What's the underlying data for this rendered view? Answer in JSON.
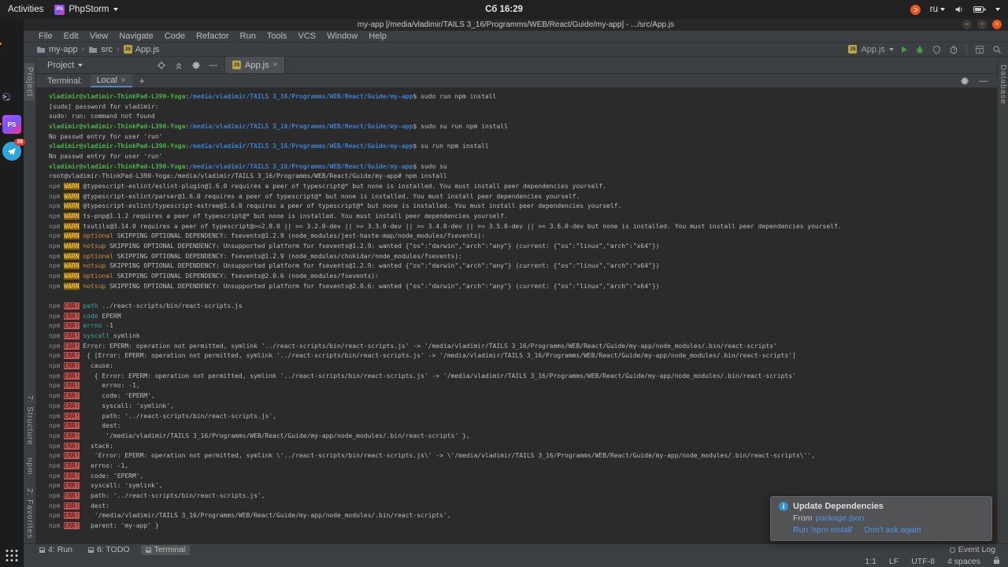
{
  "ubuntu_bar": {
    "activities": "Activities",
    "app_name": "PhpStorm",
    "clock": "Сб 16:29",
    "lang": "ru"
  },
  "window": {
    "title": "my-app [/media/vladimir/TAILS 3_16/Programms/WEB/React/Guide/my-app] - .../src/App.js"
  },
  "menu": {
    "items": [
      "File",
      "Edit",
      "View",
      "Navigate",
      "Code",
      "Refactor",
      "Run",
      "Tools",
      "VCS",
      "Window",
      "Help"
    ]
  },
  "breadcrumbs": {
    "items": [
      "my-app",
      "src",
      "App.js"
    ]
  },
  "run_widget": {
    "config": "App.js"
  },
  "project_panel": {
    "title": "Project"
  },
  "editor_tabs": {
    "active": "App.js"
  },
  "terminal_panel": {
    "label": "Terminal:",
    "tab": "Local"
  },
  "tool_stripes": {
    "left_top": "Project",
    "left_bottom": [
      "7: Structure",
      "npm",
      "2: Favorites"
    ],
    "right": "Database"
  },
  "bottom_bar": {
    "buttons": [
      "4: Run",
      "6: TODO",
      "Terminal"
    ],
    "event_log": "Event Log"
  },
  "status_bar": {
    "position": "1:1",
    "line_ending": "LF",
    "encoding": "UTF-8",
    "indent": "4 spaces"
  },
  "dock": {
    "badge": "39",
    "phpstorm_label": "PS",
    "terminal_glyph": "&gt;_"
  },
  "notification": {
    "title": "Update Dependencies",
    "from_prefix": "From",
    "from_link": "package.json",
    "action_run": "Run 'npm install'",
    "action_dismiss": "Don't ask again"
  },
  "colors": {
    "accent_link": "#5394ec",
    "terminal_green": "#4ab44a",
    "terminal_blue": "#3e7fd0",
    "warn_badge_bg": "#8a5f00",
    "error_badge_bg": "#c75450",
    "close_button": "#e95420"
  },
  "terminal": {
    "lines": [
      [
        [
          "u",
          "vladimir@vladimir-ThinkPad-L390-Yoga"
        ],
        [
          "",
          ":"
        ],
        [
          "p",
          "/media/vladimir/TAILS 3_16/Programms/WEB/React/Guide/my-app"
        ],
        [
          "",
          "$ sudo run npm install"
        ]
      ],
      [
        [
          "",
          "[sudo] password for vladimir: "
        ]
      ],
      [
        [
          "",
          "sudo: run: command not found"
        ]
      ],
      [
        [
          "u",
          "vladimir@vladimir-ThinkPad-L390-Yoga"
        ],
        [
          "",
          ":"
        ],
        [
          "p",
          "/media/vladimir/TAILS 3_16/Programms/WEB/React/Guide/my-app"
        ],
        [
          "",
          "$ sudo su run npm install"
        ]
      ],
      [
        [
          "",
          "No passwd entry for user 'run'"
        ]
      ],
      [
        [
          "u",
          "vladimir@vladimir-ThinkPad-L390-Yoga"
        ],
        [
          "",
          ":"
        ],
        [
          "p",
          "/media/vladimir/TAILS 3_16/Programms/WEB/React/Guide/my-app"
        ],
        [
          "",
          "$ su run npm install"
        ]
      ],
      [
        [
          "",
          "No passwd entry for user 'run'"
        ]
      ],
      [
        [
          "u",
          "vladimir@vladimir-ThinkPad-L390-Yoga"
        ],
        [
          "",
          ":"
        ],
        [
          "p",
          "/media/vladimir/TAILS 3_16/Programms/WEB/React/Guide/my-app"
        ],
        [
          "",
          "$ sudo su"
        ]
      ],
      [
        [
          "",
          "root@vladimir-ThinkPad-L390-Yoga:/media/vladimir/TAILS 3_16/Programms/WEB/React/Guide/my-app# npm install"
        ]
      ],
      [
        [
          "n",
          "npm "
        ],
        [
          "w",
          "WARN"
        ],
        [
          "",
          " @typescript-eslint/eslint-plugin@1.6.0 requires a peer of typescript@* but none is installed. You must install peer dependencies yourself."
        ]
      ],
      [
        [
          "n",
          "npm "
        ],
        [
          "w",
          "WARN"
        ],
        [
          "",
          " @typescript-eslint/parser@1.6.0 requires a peer of typescript@* but none is installed. You must install peer dependencies yourself."
        ]
      ],
      [
        [
          "n",
          "npm "
        ],
        [
          "w",
          "WARN"
        ],
        [
          "",
          " @typescript-eslint/typescript-estree@1.6.0 requires a peer of typescript@* but none is installed. You must install peer dependencies yourself."
        ]
      ],
      [
        [
          "n",
          "npm "
        ],
        [
          "w",
          "WARN"
        ],
        [
          "",
          " ts-pnp@1.1.2 requires a peer of typescript@* but none is installed. You must install peer dependencies yourself."
        ]
      ],
      [
        [
          "n",
          "npm "
        ],
        [
          "w",
          "WARN"
        ],
        [
          "",
          " tsutils@3.14.0 requires a peer of typescript@>=2.8.0 || >= 3.2.0-dev || >= 3.3.0-dev || >= 3.4.0-dev || >= 3.5.0-dev || >= 3.6.0-dev but none is installed. You must install peer dependencies yourself."
        ]
      ],
      [
        [
          "n",
          "npm "
        ],
        [
          "w",
          "WARN"
        ],
        [
          "",
          " "
        ],
        [
          "o",
          "optional"
        ],
        [
          "",
          " SKIPPING OPTIONAL DEPENDENCY: fsevents@1.2.9 (node_modules/jest-haste-map/node_modules/fsevents):"
        ]
      ],
      [
        [
          "n",
          "npm "
        ],
        [
          "w",
          "WARN"
        ],
        [
          "",
          " "
        ],
        [
          "o",
          "notsup"
        ],
        [
          "",
          " SKIPPING OPTIONAL DEPENDENCY: Unsupported platform for fsevents@1.2.9: wanted {\"os\":\"darwin\",\"arch\":\"any\"} (current: {\"os\":\"linux\",\"arch\":\"x64\"})"
        ]
      ],
      [
        [
          "n",
          "npm "
        ],
        [
          "w",
          "WARN"
        ],
        [
          "",
          " "
        ],
        [
          "o",
          "optional"
        ],
        [
          "",
          " SKIPPING OPTIONAL DEPENDENCY: fsevents@1.2.9 (node_modules/chokidar/node_modules/fsevents):"
        ]
      ],
      [
        [
          "n",
          "npm "
        ],
        [
          "w",
          "WARN"
        ],
        [
          "",
          " "
        ],
        [
          "o",
          "notsup"
        ],
        [
          "",
          " SKIPPING OPTIONAL DEPENDENCY: Unsupported platform for fsevents@1.2.9: wanted {\"os\":\"darwin\",\"arch\":\"any\"} (current: {\"os\":\"linux\",\"arch\":\"x64\"})"
        ]
      ],
      [
        [
          "n",
          "npm "
        ],
        [
          "w",
          "WARN"
        ],
        [
          "",
          " "
        ],
        [
          "o",
          "optional"
        ],
        [
          "",
          " SKIPPING OPTIONAL DEPENDENCY: fsevents@2.0.6 (node_modules/fsevents):"
        ]
      ],
      [
        [
          "n",
          "npm "
        ],
        [
          "w",
          "WARN"
        ],
        [
          "",
          " "
        ],
        [
          "o",
          "notsup"
        ],
        [
          "",
          " SKIPPING OPTIONAL DEPENDENCY: Unsupported platform for fsevents@2.0.6: wanted {\"os\":\"darwin\",\"arch\":\"any\"} (current: {\"os\":\"linux\",\"arch\":\"x64\"})"
        ]
      ],
      [],
      [
        [
          "n",
          "npm "
        ],
        [
          "e",
          "ERR!"
        ],
        [
          "",
          " "
        ],
        [
          "k",
          "path"
        ],
        [
          "",
          " ../react-scripts/bin/react-scripts.js"
        ]
      ],
      [
        [
          "n",
          "npm "
        ],
        [
          "e",
          "ERR!"
        ],
        [
          "",
          " "
        ],
        [
          "k",
          "code"
        ],
        [
          "",
          " EPERM"
        ]
      ],
      [
        [
          "n",
          "npm "
        ],
        [
          "e",
          "ERR!"
        ],
        [
          "",
          " "
        ],
        [
          "k",
          "errno"
        ],
        [
          "",
          " -1"
        ]
      ],
      [
        [
          "n",
          "npm "
        ],
        [
          "e",
          "ERR!"
        ],
        [
          "",
          " "
        ],
        [
          "k",
          "syscall"
        ],
        [
          "",
          " symlink"
        ]
      ],
      [
        [
          "n",
          "npm "
        ],
        [
          "e",
          "ERR!"
        ],
        [
          "",
          " Error: EPERM: operation not permitted, symlink '../react-scripts/bin/react-scripts.js' -> '/media/vladimir/TAILS 3_16/Programms/WEB/React/Guide/my-app/node_modules/.bin/react-scripts'"
        ]
      ],
      [
        [
          "n",
          "npm "
        ],
        [
          "e",
          "ERR!"
        ],
        [
          "",
          "  { [Error: EPERM: operation not permitted, symlink '../react-scripts/bin/react-scripts.js' -> '/media/vladimir/TAILS 3_16/Programms/WEB/React/Guide/my-app/node_modules/.bin/react-scripts']"
        ]
      ],
      [
        [
          "n",
          "npm "
        ],
        [
          "e",
          "ERR!"
        ],
        [
          "",
          "   cause:"
        ]
      ],
      [
        [
          "n",
          "npm "
        ],
        [
          "e",
          "ERR!"
        ],
        [
          "",
          "    { Error: EPERM: operation not permitted, symlink '../react-scripts/bin/react-scripts.js' -> '/media/vladimir/TAILS 3_16/Programms/WEB/React/Guide/my-app/node_modules/.bin/react-scripts'"
        ]
      ],
      [
        [
          "n",
          "npm "
        ],
        [
          "e",
          "ERR!"
        ],
        [
          "",
          "      errno: -1,"
        ]
      ],
      [
        [
          "n",
          "npm "
        ],
        [
          "e",
          "ERR!"
        ],
        [
          "",
          "      code: 'EPERM',"
        ]
      ],
      [
        [
          "n",
          "npm "
        ],
        [
          "e",
          "ERR!"
        ],
        [
          "",
          "      syscall: 'symlink',"
        ]
      ],
      [
        [
          "n",
          "npm "
        ],
        [
          "e",
          "ERR!"
        ],
        [
          "",
          "      path: '../react-scripts/bin/react-scripts.js',"
        ]
      ],
      [
        [
          "n",
          "npm "
        ],
        [
          "e",
          "ERR!"
        ],
        [
          "",
          "      dest:"
        ]
      ],
      [
        [
          "n",
          "npm "
        ],
        [
          "e",
          "ERR!"
        ],
        [
          "",
          "       '/media/vladimir/TAILS 3_16/Programms/WEB/React/Guide/my-app/node_modules/.bin/react-scripts' },"
        ]
      ],
      [
        [
          "n",
          "npm "
        ],
        [
          "e",
          "ERR!"
        ],
        [
          "",
          "   stack:"
        ]
      ],
      [
        [
          "n",
          "npm "
        ],
        [
          "e",
          "ERR!"
        ],
        [
          "",
          "    'Error: EPERM: operation not permitted, symlink \\'../react-scripts/bin/react-scripts.js\\' -> \\'/media/vladimir/TAILS 3_16/Programms/WEB/React/Guide/my-app/node_modules/.bin/react-scripts\\'',"
        ]
      ],
      [
        [
          "n",
          "npm "
        ],
        [
          "e",
          "ERR!"
        ],
        [
          "",
          "   errno: -1,"
        ]
      ],
      [
        [
          "n",
          "npm "
        ],
        [
          "e",
          "ERR!"
        ],
        [
          "",
          "   code: 'EPERM',"
        ]
      ],
      [
        [
          "n",
          "npm "
        ],
        [
          "e",
          "ERR!"
        ],
        [
          "",
          "   syscall: 'symlink',"
        ]
      ],
      [
        [
          "n",
          "npm "
        ],
        [
          "e",
          "ERR!"
        ],
        [
          "",
          "   path: '../react-scripts/bin/react-scripts.js',"
        ]
      ],
      [
        [
          "n",
          "npm "
        ],
        [
          "e",
          "ERR!"
        ],
        [
          "",
          "   dest:"
        ]
      ],
      [
        [
          "n",
          "npm "
        ],
        [
          "e",
          "ERR!"
        ],
        [
          "",
          "    '/media/vladimir/TAILS 3_16/Programms/WEB/React/Guide/my-app/node_modules/.bin/react-scripts',"
        ]
      ],
      [
        [
          "n",
          "npm "
        ],
        [
          "e",
          "ERR!"
        ],
        [
          "",
          "   parent: 'my-app' }"
        ]
      ]
    ]
  }
}
